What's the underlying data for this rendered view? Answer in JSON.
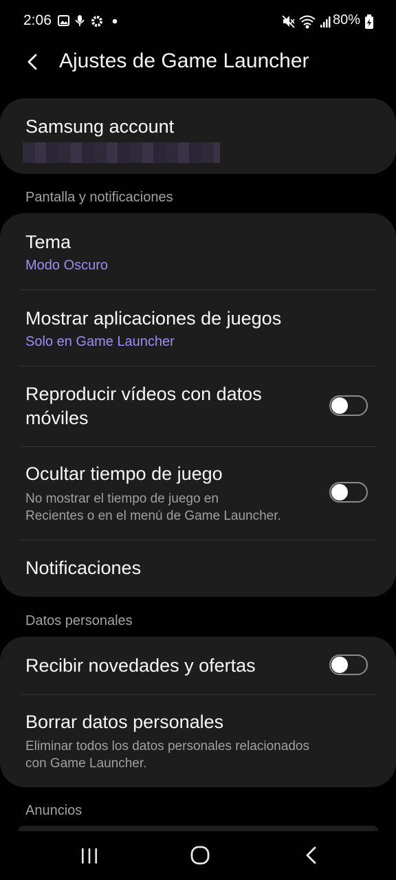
{
  "status": {
    "time": "2:06",
    "battery": "80%",
    "left_icons": [
      "image-icon",
      "mic-icon",
      "settings-icon",
      "dot-icon"
    ],
    "right_icons": [
      "mute-icon",
      "wifi-icon",
      "signal-icon",
      "battery-icon"
    ]
  },
  "header": {
    "title": "Ajustes de Game Launcher"
  },
  "account": {
    "title": "Samsung account"
  },
  "sections": {
    "display": "Pantalla y notificaciones",
    "personal": "Datos personales",
    "ads": "Anuncios"
  },
  "display_items": {
    "theme_title": "Tema",
    "theme_value": "Modo Oscuro",
    "show_apps_title": "Mostrar aplicaciones de juegos",
    "show_apps_value": "Solo en Game Launcher",
    "videos_title_line1": "Reproducir vídeos con datos",
    "videos_title_line2": "móviles",
    "videos_toggle": "off",
    "hide_time_title": "Ocultar tiempo de juego",
    "hide_time_desc_line1": "No mostrar el tiempo de juego en",
    "hide_time_desc_line2": "Recientes o en el menú de Game Launcher.",
    "hide_time_toggle": "off",
    "notifications_title": "Notificaciones"
  },
  "personal_items": {
    "offers_title": "Recibir novedades y ofertas",
    "offers_toggle": "off",
    "delete_title": "Borrar datos personales",
    "delete_desc_line1": "Eliminar todos los datos personales relacionados",
    "delete_desc_line2": "con Game Launcher."
  },
  "colors": {
    "background": "#010101",
    "card": "#1d1d1d",
    "accent": "#9b8ef6",
    "secondary_text": "#a0a0a0"
  }
}
